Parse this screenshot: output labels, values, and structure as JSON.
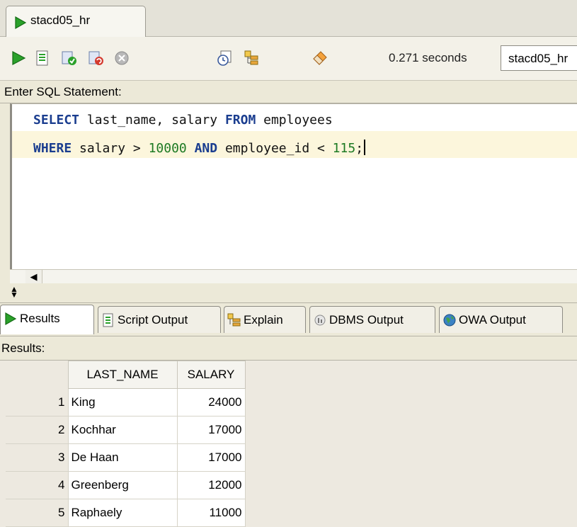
{
  "connection_tab": {
    "label": "stacd05_hr",
    "icon": "play-triangle-icon"
  },
  "toolbar": {
    "buttons": [
      {
        "icon": "run-statement-icon"
      },
      {
        "icon": "run-script-icon"
      },
      {
        "icon": "commit-icon"
      },
      {
        "icon": "rollback-icon"
      },
      {
        "icon": "cancel-icon"
      },
      {
        "icon": "sql-history-icon"
      },
      {
        "icon": "execute-explain-plan-icon"
      },
      {
        "icon": "clear-eraser-icon"
      }
    ],
    "timing": "0.271 seconds",
    "connection_select": "stacd05_hr"
  },
  "editor": {
    "label": "Enter SQL Statement:",
    "line1": {
      "kw1": "SELECT",
      "t1": " last_name, salary ",
      "kw2": "FROM",
      "t2": " employees"
    },
    "line2": {
      "kw1": "WHERE",
      "t1": " salary > ",
      "num1": "10000",
      "t2": " ",
      "kw2": "AND",
      "t3": " employee_id < ",
      "num2": "115",
      "t4": ";"
    }
  },
  "result_tabs": [
    {
      "label": "Results",
      "icon": "play-triangle-icon",
      "active": true
    },
    {
      "label": "Script Output",
      "icon": "script-output-icon"
    },
    {
      "label": "Explain",
      "icon": "explain-plan-icon"
    },
    {
      "label": "DBMS Output",
      "icon": "dbms-output-icon"
    },
    {
      "label": "OWA Output",
      "icon": "globe-icon"
    }
  ],
  "results": {
    "label": "Results:",
    "columns": [
      "LAST_NAME",
      "SALARY"
    ],
    "rows": [
      {
        "n": "1",
        "last_name": "King",
        "salary": "24000"
      },
      {
        "n": "2",
        "last_name": "Kochhar",
        "salary": "17000"
      },
      {
        "n": "3",
        "last_name": "De Haan",
        "salary": "17000"
      },
      {
        "n": "4",
        "last_name": "Greenberg",
        "salary": "12000"
      },
      {
        "n": "5",
        "last_name": "Raphaely",
        "salary": "11000"
      }
    ]
  },
  "colors": {
    "keyword": "#1a3d8f",
    "number": "#1d7a23",
    "current_line": "#fcf6dc",
    "run_green": "#2aa12a"
  }
}
